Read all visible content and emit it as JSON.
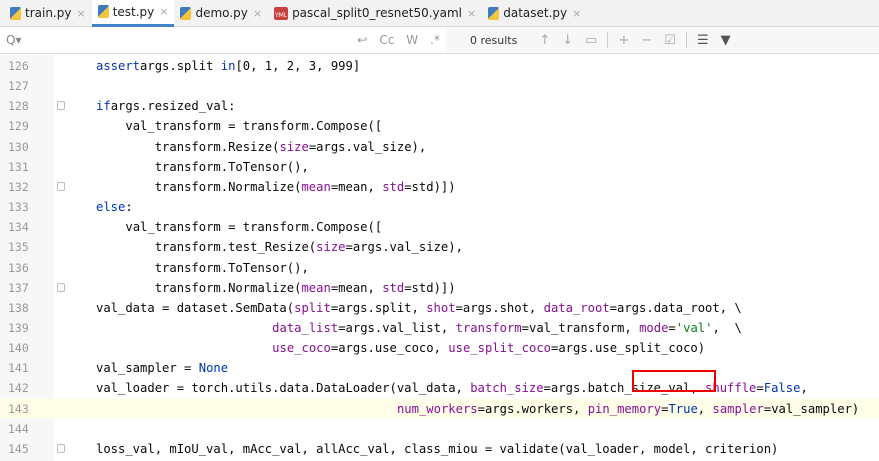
{
  "tabs": [
    {
      "label": "train.py",
      "icon": "python"
    },
    {
      "label": "test.py",
      "icon": "python",
      "active": true
    },
    {
      "label": "demo.py",
      "icon": "python"
    },
    {
      "label": "pascal_split0_resnet50.yaml",
      "icon": "yaml"
    },
    {
      "label": "dataset.py",
      "icon": "python"
    }
  ],
  "search": {
    "placeholder": "Q▾",
    "match_case": "Cc",
    "words": "W",
    "regex": ".*",
    "results": "0 results"
  },
  "lines": [
    {
      "n": "126",
      "indent": 0,
      "tokens": [
        [
          "k",
          "assert"
        ],
        [
          "",
          "args.split "
        ],
        [
          "k",
          "in"
        ],
        [
          "",
          "[0, 1, 2, 3, 999]"
        ]
      ]
    },
    {
      "n": "127",
      "indent": 0,
      "tokens": []
    },
    {
      "n": "128",
      "indent": 0,
      "fold": true,
      "tokens": [
        [
          "k",
          "if"
        ],
        [
          "",
          "args.resized_val:"
        ]
      ]
    },
    {
      "n": "129",
      "indent": 4,
      "tokens": [
        [
          "",
          "val_transform = transform.Compose(["
        ]
      ]
    },
    {
      "n": "130",
      "indent": 8,
      "tokens": [
        [
          "",
          "transform.Resize("
        ],
        [
          "p",
          "size"
        ],
        [
          "",
          "=args.val_size),"
        ]
      ]
    },
    {
      "n": "131",
      "indent": 8,
      "tokens": [
        [
          "",
          "transform.ToTensor(),"
        ]
      ]
    },
    {
      "n": "132",
      "indent": 8,
      "fold": true,
      "tokens": [
        [
          "",
          "transform.Normalize("
        ],
        [
          "p",
          "mean"
        ],
        [
          "",
          "=mean, "
        ],
        [
          "p",
          "std"
        ],
        [
          "",
          "=std)])"
        ]
      ]
    },
    {
      "n": "133",
      "indent": 0,
      "tokens": [
        [
          "k",
          "else"
        ],
        [
          "",
          ":"
        ]
      ]
    },
    {
      "n": "134",
      "indent": 4,
      "tokens": [
        [
          "",
          "val_transform = transform.Compose(["
        ]
      ]
    },
    {
      "n": "135",
      "indent": 8,
      "tokens": [
        [
          "",
          "transform.test_Resize("
        ],
        [
          "p",
          "size"
        ],
        [
          "",
          "=args.val_size),"
        ]
      ]
    },
    {
      "n": "136",
      "indent": 8,
      "tokens": [
        [
          "",
          "transform.ToTensor(),"
        ]
      ]
    },
    {
      "n": "137",
      "indent": 8,
      "fold": true,
      "tokens": [
        [
          "",
          "transform.Normalize("
        ],
        [
          "p",
          "mean"
        ],
        [
          "",
          "=mean, "
        ],
        [
          "p",
          "std"
        ],
        [
          "",
          "=std)])"
        ]
      ]
    },
    {
      "n": "138",
      "indent": 0,
      "tokens": [
        [
          "",
          "val_data = dataset.SemData("
        ],
        [
          "p",
          "split"
        ],
        [
          "",
          "=args.split, "
        ],
        [
          "p",
          "shot"
        ],
        [
          "",
          "=args.shot, "
        ],
        [
          "p",
          "data_root"
        ],
        [
          "",
          "=args.data_root, \\"
        ]
      ]
    },
    {
      "n": "139",
      "indent": 24,
      "tokens": [
        [
          "p",
          "data_list"
        ],
        [
          "",
          "=args.val_list, "
        ],
        [
          "p",
          "transform"
        ],
        [
          "",
          "=val_transform, "
        ],
        [
          "p",
          "mode"
        ],
        [
          "",
          "="
        ],
        [
          "s",
          "'val'"
        ],
        [
          "",
          ",  \\"
        ]
      ]
    },
    {
      "n": "140",
      "indent": 24,
      "tokens": [
        [
          "p",
          "use_coco"
        ],
        [
          "",
          "=args.use_coco, "
        ],
        [
          "p",
          "use_split_coco"
        ],
        [
          "",
          "=args.use_split_coco)"
        ]
      ]
    },
    {
      "n": "141",
      "indent": 0,
      "tokens": [
        [
          "",
          "val_sampler = "
        ],
        [
          "k",
          "None"
        ]
      ]
    },
    {
      "n": "142",
      "indent": 0,
      "tokens": [
        [
          "",
          "val_loader = torch.utils.data.DataLoader(val_data, "
        ],
        [
          "p",
          "batch_size"
        ],
        [
          "",
          "=args.batch_size_val, "
        ],
        [
          "p",
          "shuffle"
        ],
        [
          "",
          "="
        ],
        [
          "k",
          "False"
        ],
        [
          "",
          ","
        ]
      ]
    },
    {
      "n": "143",
      "indent": 41,
      "current": true,
      "tokens": [
        [
          "p",
          "num_workers"
        ],
        [
          "",
          "=args.workers, "
        ],
        [
          "p",
          "pin_memory"
        ],
        [
          "",
          "="
        ],
        [
          "k",
          "True"
        ],
        [
          "",
          ", "
        ],
        [
          "p",
          "sampler"
        ],
        [
          "",
          "=val_sampler)"
        ]
      ]
    },
    {
      "n": "144",
      "indent": 0,
      "tokens": []
    },
    {
      "n": "145",
      "indent": 0,
      "fold": true,
      "tokens": [
        [
          "",
          "loss_val, mIoU_val, mAcc_val, allAcc_val, class_miou = validate(val_loader, model, criterion)"
        ]
      ]
    }
  ]
}
